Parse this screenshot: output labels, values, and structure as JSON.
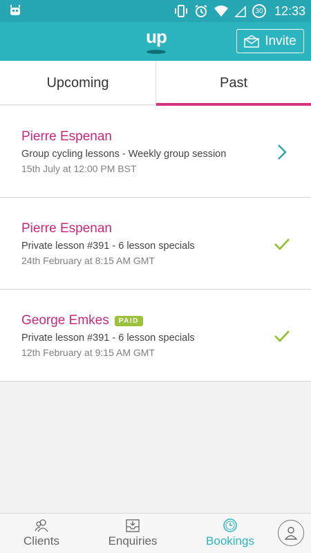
{
  "status_bar": {
    "time": "12:33",
    "badge": "30"
  },
  "app_bar": {
    "logo_text": "up",
    "invite_label": "Invite"
  },
  "tabs": [
    {
      "label": "Upcoming",
      "active": false
    },
    {
      "label": "Past",
      "active": true
    }
  ],
  "bookings": [
    {
      "name": "Pierre Espenan",
      "description": "Group cycling lessons - Weekly group session",
      "date": "15th July at 12:00 PM BST",
      "status_icon": "chevron-right-icon",
      "paid_badge": ""
    },
    {
      "name": "Pierre Espenan",
      "description": "Private lesson #391 - 6 lesson specials",
      "date": "24th February at 8:15 AM GMT",
      "status_icon": "checkmark-icon",
      "paid_badge": ""
    },
    {
      "name": "George Emkes",
      "description": "Private lesson #391 - 6 lesson specials",
      "date": "12th February at 9:15 AM GMT",
      "status_icon": "checkmark-icon",
      "paid_badge": "PAID"
    }
  ],
  "bottom_nav": [
    {
      "label": "Clients",
      "icon": "clients-icon",
      "active": false
    },
    {
      "label": "Enquiries",
      "icon": "inbox-icon",
      "active": false
    },
    {
      "label": "Bookings",
      "icon": "clock-icon",
      "active": true
    }
  ],
  "colors": {
    "teal": "#2db5bf",
    "magenta": "#c8297a",
    "tab_indicator": "#d6337f",
    "paid_green": "#9cc23b",
    "check_green": "#8fbf2c"
  }
}
